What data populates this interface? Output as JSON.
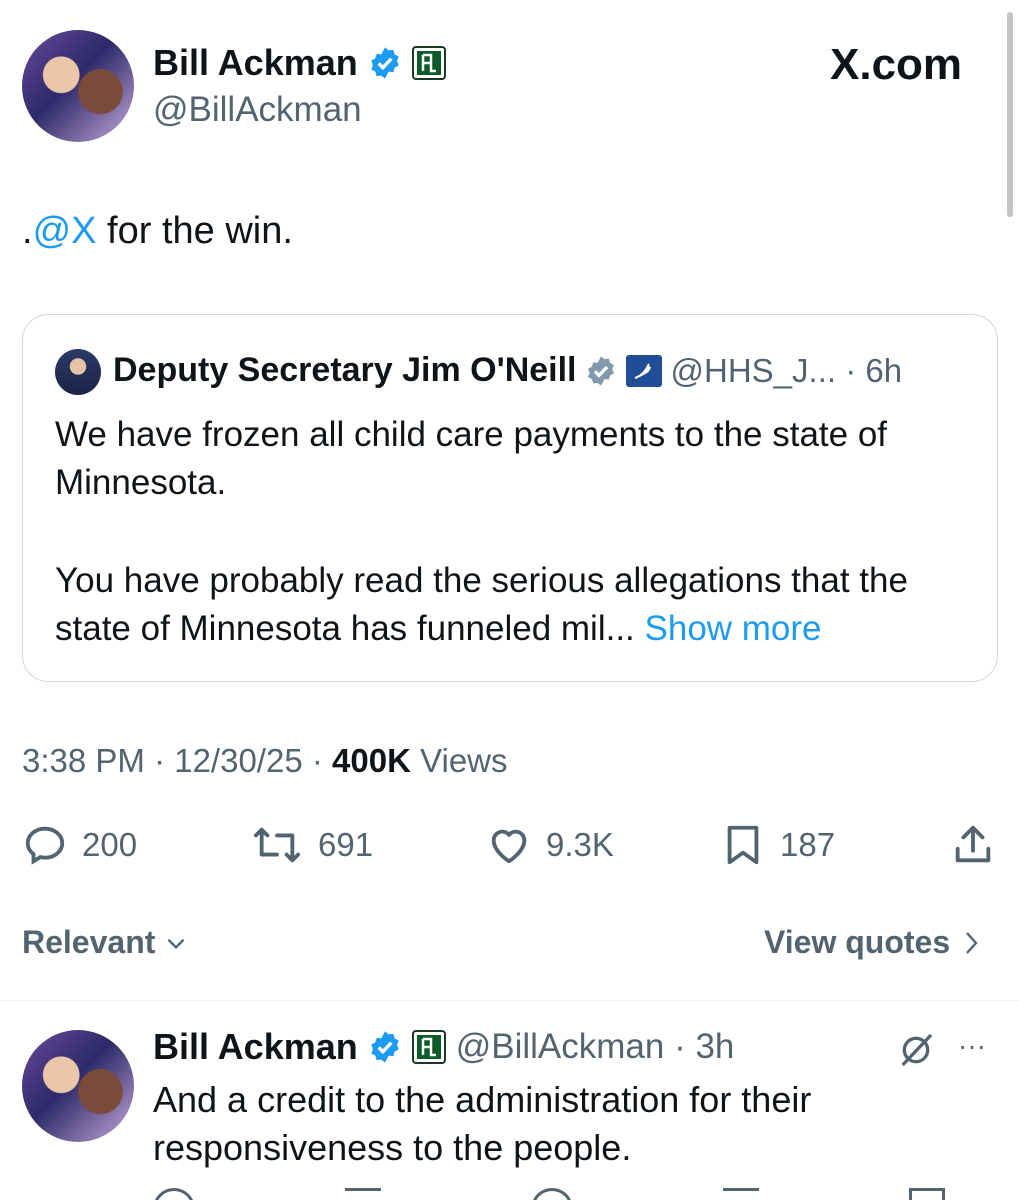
{
  "brand": {
    "watermark": "X.com"
  },
  "tweet": {
    "author_name": "Bill Ackman",
    "handle": "@BillAckman",
    "text_prefix": ".",
    "text_mention": "@X",
    "text_suffix": " for the win.",
    "timestamp": "3:38 PM · 12/30/25 · ",
    "views_count": "400K",
    "views_label": " Views",
    "stats": {
      "replies": "200",
      "reposts": "691",
      "likes": "9.3K",
      "bookmarks": "187"
    }
  },
  "quoted": {
    "author_name": "Deputy Secretary Jim O'Neill",
    "handle_time": "@HHS_J... · 6h",
    "para1": "We have frozen all child care payments to the state of Minnesota.",
    "para2": "You have probably read the serious allegations that the state of Minnesota has funneled mil...",
    "show_more": " Show more"
  },
  "replies_bar": {
    "sort_label": "Relevant",
    "view_quotes": "View quotes"
  },
  "reply": {
    "author_name": "Bill Ackman",
    "handle_time": "@BillAckman · 3h",
    "text": "And a credit to the administration for their responsiveness to the people.",
    "more": "···"
  },
  "colors": {
    "accent": "#1d9bf0",
    "gray": "#536471",
    "verified_gold": "#0c5c2a"
  }
}
